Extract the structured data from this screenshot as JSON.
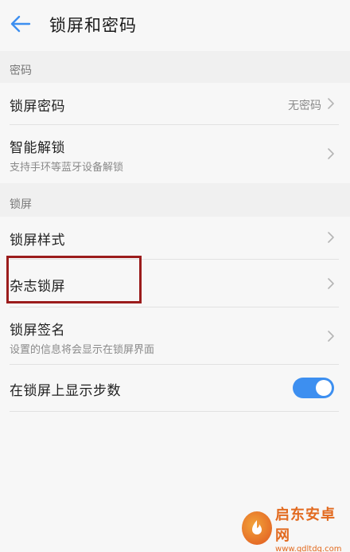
{
  "header": {
    "title": "锁屏和密码",
    "back_icon": "arrow-left-icon"
  },
  "colors": {
    "accent": "#3d8ff0",
    "highlight_box": "#9b1c1c",
    "watermark": "#e26a1f"
  },
  "sections": {
    "password": {
      "label": "密码",
      "lock_password": {
        "label": "锁屏密码",
        "value": "无密码"
      },
      "smart_unlock": {
        "label": "智能解锁",
        "subtitle": "支持手环等蓝牙设备解锁"
      }
    },
    "lockscreen": {
      "label": "锁屏",
      "style": {
        "label": "锁屏样式"
      },
      "magazine": {
        "label": "杂志锁屏"
      },
      "signature": {
        "label": "锁屏签名",
        "subtitle": "设置的信息将会显示在锁屏界面"
      },
      "steps": {
        "label": "在锁屏上显示步数",
        "enabled": true
      }
    }
  },
  "watermark": {
    "title": "启东安卓网",
    "url": "www.qdltdq.com"
  }
}
